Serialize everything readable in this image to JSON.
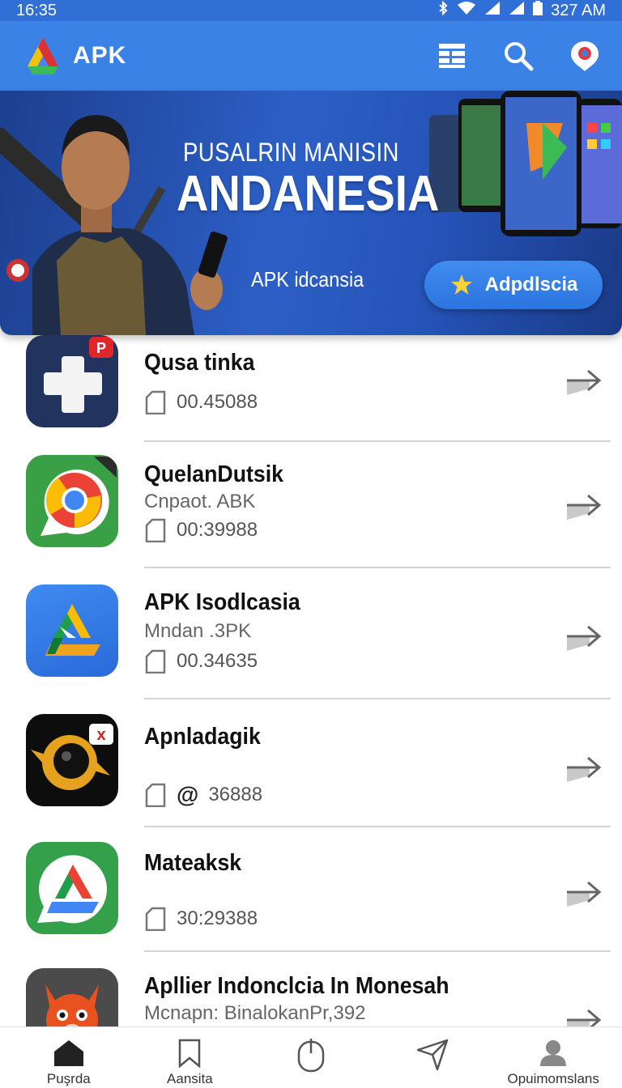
{
  "status_bar": {
    "time": "16:35",
    "right_text": "327 AM"
  },
  "app_bar": {
    "title": "APK",
    "actions": [
      "list-icon",
      "search-icon",
      "profile-icon"
    ]
  },
  "banner": {
    "subtitle": "PUSALRIN MANISIN",
    "title": "ANDANESIA",
    "caption": "APK idcansia",
    "button_label": "Adpdlscia"
  },
  "apps": [
    {
      "name": "Qusa tinka",
      "subtitle": "",
      "meta": "00.45088",
      "icon": "plus-app-icon"
    },
    {
      "name": "QuelanDutsik",
      "subtitle": "Cnpaot. ABK",
      "meta": "00:39988",
      "icon": "chrome-like-app-icon"
    },
    {
      "name": "APK Isodlcasia",
      "subtitle": "Mndan .3PK",
      "meta": "00.34635",
      "icon": "drive-like-app-icon"
    },
    {
      "name": "Apnladagik",
      "subtitle": "",
      "meta": "36888",
      "meta_prefix": "@",
      "icon": "camera-app-icon"
    },
    {
      "name": "Mateaksk",
      "subtitle": "",
      "meta": "30:29388",
      "icon": "drive-chat-app-icon"
    },
    {
      "name": "Apllier Indonclcia In Monesah",
      "subtitle": "Mcnapn:  BinalokanPr,392",
      "meta": "",
      "icon": "fox-app-icon"
    }
  ],
  "bottom_nav": [
    {
      "label": "Puşrda",
      "icon": "home-icon"
    },
    {
      "label": "Aansita",
      "icon": "bookmark-icon"
    },
    {
      "label": "",
      "icon": "mouse-icon"
    },
    {
      "label": "",
      "icon": "send-icon"
    },
    {
      "label": "Opuimomslans",
      "icon": "account-icon"
    }
  ],
  "colors": {
    "primary": "#3b82e6",
    "status": "#2f6fd6",
    "banner": "#2553b8"
  }
}
